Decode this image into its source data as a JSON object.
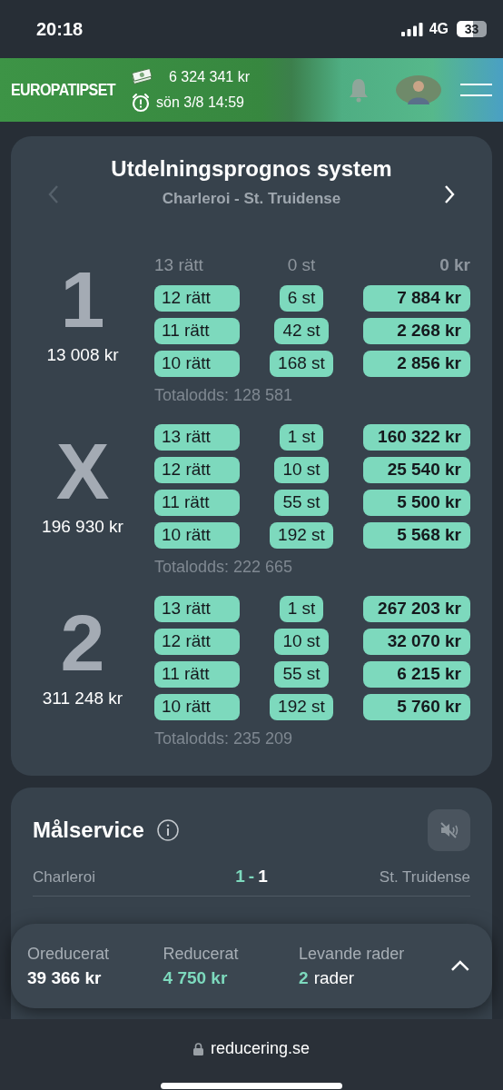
{
  "status_bar": {
    "time": "20:18",
    "network": "4G",
    "battery": "33"
  },
  "header": {
    "logo": "EUROPATIPSET",
    "jackpot": "6 324 341 kr",
    "deadline": "sön 3/8 14:59"
  },
  "prognosis": {
    "title": "Utdelningsprognos system",
    "match": "Charleroi - St. Truidense",
    "previous_disabled": true,
    "next_disabled": false,
    "groups": [
      {
        "sign": "1",
        "amount": "13 008 kr",
        "total": "Totalodds: 128 581",
        "rows": [
          {
            "label": "13 rätt",
            "count": "0 st",
            "payout": "0 kr",
            "highlighted": false
          },
          {
            "label": "12 rätt",
            "count": "6 st",
            "payout": "7 884 kr",
            "highlighted": true
          },
          {
            "label": "11 rätt",
            "count": "42 st",
            "payout": "2 268 kr",
            "highlighted": true
          },
          {
            "label": "10 rätt",
            "count": "168 st",
            "payout": "2 856 kr",
            "highlighted": true
          }
        ]
      },
      {
        "sign": "X",
        "amount": "196 930 kr",
        "total": "Totalodds: 222 665",
        "rows": [
          {
            "label": "13 rätt",
            "count": "1 st",
            "payout": "160 322 kr",
            "highlighted": true
          },
          {
            "label": "12 rätt",
            "count": "10 st",
            "payout": "25 540 kr",
            "highlighted": true
          },
          {
            "label": "11 rätt",
            "count": "55 st",
            "payout": "5 500 kr",
            "highlighted": true
          },
          {
            "label": "10 rätt",
            "count": "192 st",
            "payout": "5 568 kr",
            "highlighted": true
          }
        ]
      },
      {
        "sign": "2",
        "amount": "311 248 kr",
        "total": "Totalodds: 235 209",
        "rows": [
          {
            "label": "13 rätt",
            "count": "1 st",
            "payout": "267 203 kr",
            "highlighted": true
          },
          {
            "label": "12 rätt",
            "count": "10 st",
            "payout": "32 070 kr",
            "highlighted": true
          },
          {
            "label": "11 rätt",
            "count": "55 st",
            "payout": "6 215 kr",
            "highlighted": true
          },
          {
            "label": "10 rätt",
            "count": "192 st",
            "payout": "5 760 kr",
            "highlighted": true
          }
        ]
      }
    ]
  },
  "goal_service": {
    "title": "Målservice",
    "matches": [
      {
        "home": "Charleroi",
        "home_score": "1",
        "separator": "-",
        "away_score": "1",
        "away": "St. Truidense"
      }
    ]
  },
  "summary": {
    "items": [
      {
        "kind": "plain",
        "label": "Oreducerat",
        "value": "39 366 kr"
      },
      {
        "kind": "accent",
        "label": "Reducerat",
        "value": "4 750 kr"
      },
      {
        "kind": "count",
        "label": "Levande rader",
        "value": "2",
        "unit": "rader"
      }
    ]
  },
  "browser": {
    "url": "reducering.se"
  }
}
